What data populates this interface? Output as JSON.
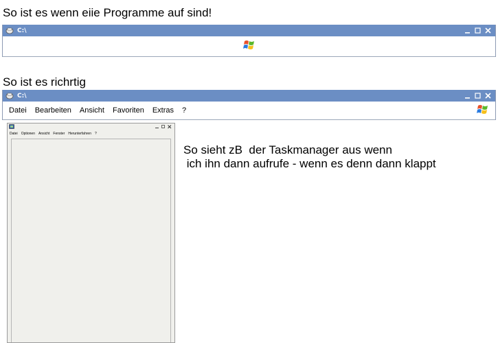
{
  "caption_top": "So ist es wenn eiie Programme auf sind!",
  "caption_mid": "So ist es richrtig",
  "window1": {
    "title": "C:\\"
  },
  "window2": {
    "title": "C:\\",
    "menu": [
      "Datei",
      "Bearbeiten",
      "Ansicht",
      "Favoriten",
      "Extras",
      "?"
    ]
  },
  "taskmanager": {
    "menu": [
      "Datei",
      "Optionen",
      "Ansicht",
      "Fenster",
      "Herunterfahren",
      "?"
    ]
  },
  "note_line1": "So sieht zB  der Taskmanager aus wenn",
  "note_line2": " ich ihn dann aufrufe - wenn es denn dann klappt",
  "colors": {
    "titlebar": "#6b8ec4",
    "border": "#8c9ab2"
  }
}
